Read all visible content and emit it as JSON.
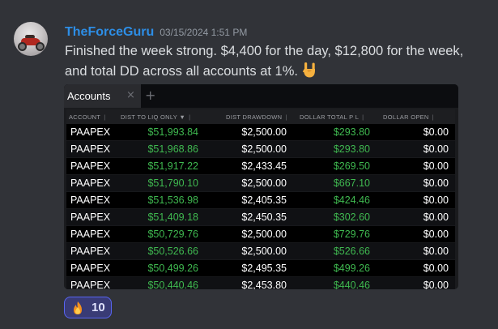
{
  "message": {
    "username": "TheForceGuru",
    "timestamp": "03/15/2024 1:51 PM",
    "text": "Finished the week strong.  $4,400 for the day, $12,800 for the week, and total DD across all accounts at 1%.",
    "emoji": "sign-of-the-horns-hand"
  },
  "panel": {
    "tab_label": "Accounts",
    "tab_close": "×",
    "tab_add": "+",
    "columns": [
      "ACCOUNT",
      "DIST TO LIQ ONLY ▼",
      "DIST DRAWDOWN",
      "DOLLAR TOTAL P L",
      "DOLLAR OPEN"
    ],
    "column_separator": "|",
    "rows": [
      [
        "PAAPEX",
        "$51,993.84",
        "$2,500.00",
        "$293.80",
        "$0.00"
      ],
      [
        "PAAPEX",
        "$51,968.86",
        "$2,500.00",
        "$293.80",
        "$0.00"
      ],
      [
        "PAAPEX",
        "$51,917.22",
        "$2,433.45",
        "$269.50",
        "$0.00"
      ],
      [
        "PAAPEX",
        "$51,790.10",
        "$2,500.00",
        "$667.10",
        "$0.00"
      ],
      [
        "PAAPEX",
        "$51,536.98",
        "$2,405.35",
        "$424.46",
        "$0.00"
      ],
      [
        "PAAPEX",
        "$51,409.18",
        "$2,450.35",
        "$302.60",
        "$0.00"
      ],
      [
        "PAAPEX",
        "$50,729.76",
        "$2,500.00",
        "$729.76",
        "$0.00"
      ],
      [
        "PAAPEX",
        "$50,526.66",
        "$2,500.00",
        "$526.66",
        "$0.00"
      ],
      [
        "PAAPEX",
        "$50,499.26",
        "$2,495.35",
        "$499.26",
        "$0.00"
      ],
      [
        "PAAPEX",
        "$50,440.46",
        "$2,453.80",
        "$440.46",
        "$0.00"
      ]
    ]
  },
  "reaction": {
    "emoji": "fire-emoji",
    "count": "10"
  },
  "colors": {
    "background": "#313338",
    "username": "#2d8ee6",
    "profit_green": "#3fb950",
    "reaction_border": "#5865f2"
  }
}
